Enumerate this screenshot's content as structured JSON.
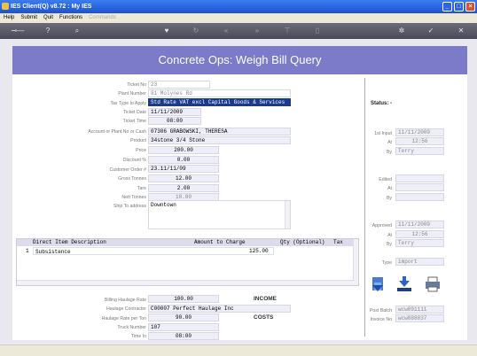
{
  "window": {
    "title": "IES Client(Q) v8.72 : My IES"
  },
  "menu": {
    "help": "Help",
    "submit": "Submit",
    "quit": "Quit",
    "functions": "Functions",
    "commands": "Commands"
  },
  "header": {
    "title": "Concrete Ops: Weigh Bill Query"
  },
  "form": {
    "ticket_no": {
      "label": "Ticket No",
      "value": "23"
    },
    "plant_number": {
      "label": "Plant Number",
      "value": "81 Molynes Rd"
    },
    "tax_type": {
      "label": "Tax Type to Apply",
      "value": "Std Rate VAT excl Capital Goods & Services"
    },
    "ticket_date": {
      "label": "Ticket Date",
      "value": "11/11/2009"
    },
    "ticket_time": {
      "label": "Ticket Time",
      "value": "08:00"
    },
    "account": {
      "label": "Account or Plant No or Cash",
      "value": "07306 GRABOWSKI, THERESA"
    },
    "product": {
      "label": "Product",
      "value": "34stone 3/4 Stone"
    },
    "price": {
      "label": "Price",
      "value": "200.00"
    },
    "discount": {
      "label": "Discount %",
      "value": "0.00"
    },
    "customer_order": {
      "label": "Customer Order #",
      "value": "23.11/11/09"
    },
    "gross_tonnes": {
      "label": "Gross Tonnes",
      "value": "12.00"
    },
    "tare": {
      "label": "Tare",
      "value": "2.00"
    },
    "nett_tonnes": {
      "label": "Nett Tonnes",
      "value": "10.00"
    },
    "ship_to": {
      "label": "Ship To address",
      "value": "Downtown"
    }
  },
  "grid": {
    "headers": [
      "Direct Item Description",
      "Amount to Charge",
      "Qty (Optional)",
      "Tax"
    ],
    "rows": [
      {
        "num": "1",
        "description": "Subsistence",
        "amount": "125.00"
      }
    ]
  },
  "haulage": {
    "billing_rate": {
      "label": "Billing Haulage Rate",
      "value": "100.00"
    },
    "income": "INCOME",
    "contractor": {
      "label": "Haulage Contractor",
      "value": "C00007 Perfect Haulage Inc"
    },
    "rate_per_ton": {
      "label": "Haulage Rate per Ton",
      "value": "90.00"
    },
    "costs": "COSTS",
    "truck": {
      "label": "Truck Number",
      "value": "107"
    },
    "time_in": {
      "label": "Time In",
      "value": "08:00"
    }
  },
  "side": {
    "status_label": "Status: -",
    "first_input": {
      "label": "1st Input",
      "value": "11/11/2009"
    },
    "at1": {
      "label": "At",
      "value": "12:56"
    },
    "by1": {
      "label": "By",
      "value": "Terry"
    },
    "edited": {
      "label": "Edited",
      "value": ""
    },
    "at2": {
      "label": "At",
      "value": ""
    },
    "by2": {
      "label": "By",
      "value": ""
    },
    "approved": {
      "label": "Approved",
      "value": "11/11/2009"
    },
    "at3": {
      "label": "At",
      "value": "12:56"
    },
    "by3": {
      "label": "By",
      "value": "Terry"
    },
    "type": {
      "label": "Type",
      "value": "import"
    },
    "post_batch": {
      "label": "Post Batch",
      "value": "wcw891111"
    },
    "invoice_no": {
      "label": "Invoice No",
      "value": "wcw888837"
    }
  },
  "colors": {
    "header_bg": "#7b7bc9",
    "selected_field": "#1c3a8c",
    "field_bg": "#eeeef8"
  }
}
